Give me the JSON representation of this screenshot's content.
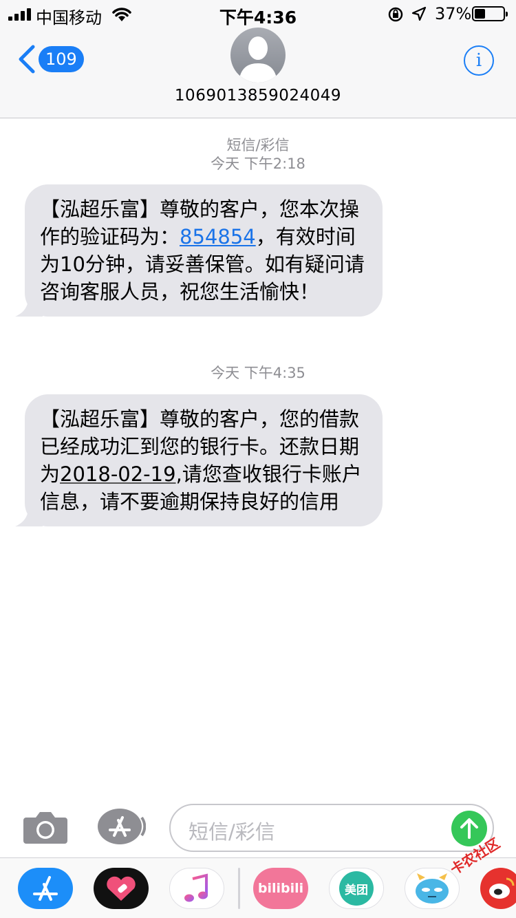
{
  "status_bar": {
    "carrier": "中国移动",
    "time": "下午4:36",
    "battery_text": "37%",
    "battery_level": 0.37
  },
  "header": {
    "back_count": "109",
    "contact": "1069013859024049",
    "info_glyph": "i"
  },
  "messages": [
    {
      "meta_service": "短信/彩信",
      "meta_time": "今天 下午2:18",
      "text_a": "【泓超乐富】尊敬的客户，您本次操作的验证码为：",
      "code": "854854",
      "text_b": "，有效时间为10分钟，请妥善保管。如有疑问请咨询客服人员，祝您生活愉快！"
    },
    {
      "meta_time": "今天 下午4:35",
      "text_a": "【泓超乐富】尊敬的客户，您的借款已经成功汇到您的银行卡。还款日期为",
      "date": "2018-02-19",
      "text_b": ",请您查收银行卡账户信息，请不要逾期保持良好的信用"
    }
  ],
  "composer": {
    "placeholder": "短信/彩信"
  },
  "drawer": {
    "apps": [
      {
        "name": "app-store",
        "icon": "app-store-icon",
        "color": "#1c8ef9"
      },
      {
        "name": "heart-app",
        "icon": "heart-icon",
        "color": "#111111"
      },
      {
        "name": "music",
        "icon": "music-note-icon",
        "color": "#ffffff"
      },
      {
        "name": "bilibili",
        "label": "bilibili",
        "color": "#f27699"
      },
      {
        "name": "meituan",
        "label": "美团",
        "color": "#2bb9a2"
      },
      {
        "name": "monster-sticker",
        "icon": "monster-icon",
        "color": "#49b6e6"
      },
      {
        "name": "weibo",
        "icon": "weibo-icon",
        "color": "#e6322e"
      }
    ],
    "watermark": "卡农社区"
  },
  "colors": {
    "accent": "#1a7ef6",
    "bubble": "#e5e5ea",
    "send": "#35c759"
  }
}
